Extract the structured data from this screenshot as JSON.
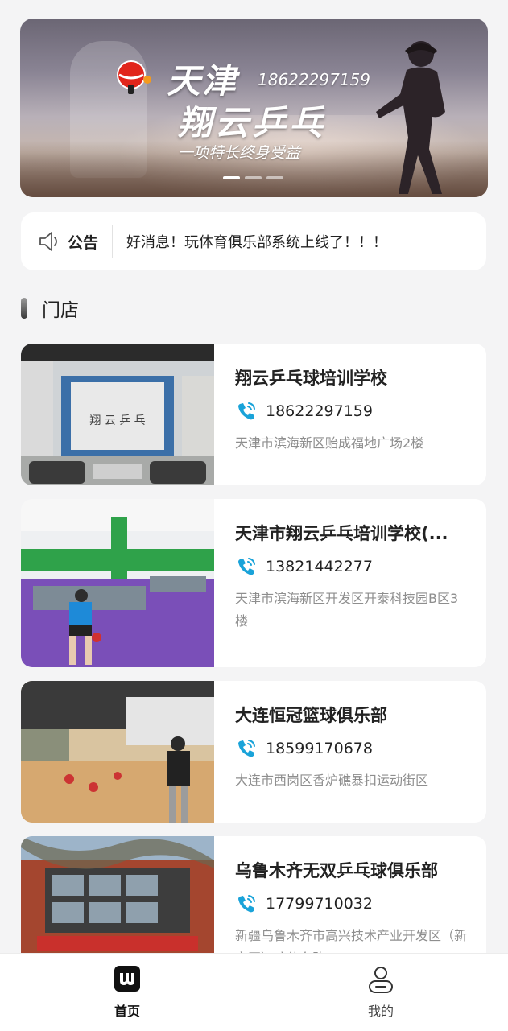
{
  "banner": {
    "title_line1": "天津",
    "phone": "18622297159",
    "title_line2": "翔云乒乓",
    "slogan": "一项特长终身受益",
    "slides": 3,
    "active_slide": 1
  },
  "notice": {
    "label": "公告",
    "text": "好消息！玩体育俱乐部系统上线了！！！",
    "icon": "speaker-icon"
  },
  "section": {
    "title": "门店"
  },
  "stores": [
    {
      "name": "翔云乒乓球培训学校",
      "phone": "18622297159",
      "address": "天津市滨海新区贻成福地广场2楼"
    },
    {
      "name": "天津市翔云乒乓培训学校(...",
      "phone": "13821442277",
      "address": "天津市滨海新区开发区开泰科技园B区3楼"
    },
    {
      "name": "大连恒冠篮球俱乐部",
      "phone": "18599170678",
      "address": "大连市西岗区香炉礁暴扣运动街区"
    },
    {
      "name": "乌鲁木齐无双乒乓球俱乐部",
      "phone": "17799710032",
      "address": "新疆乌鲁木齐市高兴技术产业开发区（新市区）喀什东路..."
    }
  ],
  "tabbar": {
    "home_label": "首页",
    "me_label": "我的"
  },
  "colors": {
    "accent": "#1aa3d9",
    "background": "#f4f4f5"
  }
}
